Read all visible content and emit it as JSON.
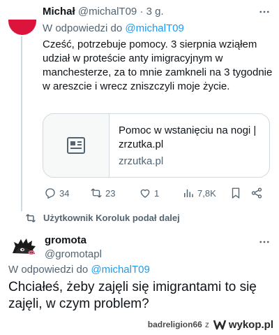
{
  "tweet1": {
    "author_name": "Michał",
    "author_handle": "@michalT09",
    "time": "3 g.",
    "more_icon": "more-dots-icon",
    "reply_prefix": "W odpowiedzi do",
    "reply_handle": "@michalT09",
    "text": "Cześć, potrzebuje pomocy. 3 sierpnia wziąłem udział w proteście anty imigracyjnym w manchesterze, za to mnie zamkneli na 3 tygodnie w areszcie i wrecz zniszczyli moje życie.",
    "card": {
      "title": "Pomoc w wstanięciu na nogi | zrzutka.pl",
      "domain": "zrzutka.pl",
      "icon": "article-icon"
    },
    "actions": {
      "replies": "34",
      "retweets": "23",
      "likes": "1",
      "views": "7,8K"
    }
  },
  "retweet_notice": "Użytkownik Koroluk podał dalej",
  "tweet2": {
    "author_name": "gromota",
    "author_handle": "@gromotapl",
    "reply_prefix": "W odpowiedzi do",
    "reply_handle": "@michalT09",
    "text": "Chciałeś, żeby zajęli się imigrantami to się zajęli, w czym problem?"
  },
  "footer": {
    "username": "badreligion66",
    "separator": "z",
    "brand": "wykop.pl"
  },
  "colors": {
    "link": "#1d9bf0",
    "muted": "#536471",
    "flag_red": "#dc143c"
  }
}
